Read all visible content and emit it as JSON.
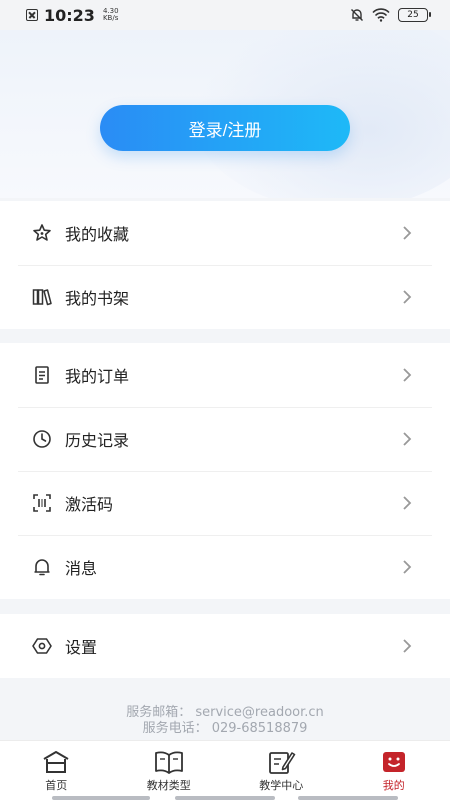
{
  "status_bar": {
    "time": "10:23",
    "speed_value": "4.30",
    "speed_unit": "KB/s",
    "battery": "25"
  },
  "hero": {
    "login_label": "登录/注册"
  },
  "group1": [
    {
      "label": "我的收藏",
      "icon": "star-icon"
    },
    {
      "label": "我的书架",
      "icon": "bookshelf-icon"
    }
  ],
  "group2": [
    {
      "label": "我的订单",
      "icon": "order-icon"
    },
    {
      "label": "历史记录",
      "icon": "clock-icon"
    },
    {
      "label": "激活码",
      "icon": "scan-code-icon"
    },
    {
      "label": "消息",
      "icon": "bell-icon"
    }
  ],
  "group3": [
    {
      "label": "设置",
      "icon": "settings-icon"
    }
  ],
  "footer": {
    "email": "服务邮箱：  service@readoor.cn",
    "phone": "服务电话：  029-68518879"
  },
  "tabbar": {
    "items": [
      {
        "label": "首页",
        "icon": "home-icon"
      },
      {
        "label": "教材类型",
        "icon": "book-icon"
      },
      {
        "label": "教学中心",
        "icon": "edit-icon"
      },
      {
        "label": "我的",
        "icon": "profile-icon"
      }
    ],
    "active_index": 3
  },
  "colors": {
    "accent_start": "#2a8cf5",
    "accent_end": "#1eb9f7",
    "active_tab": "#c4242a"
  }
}
